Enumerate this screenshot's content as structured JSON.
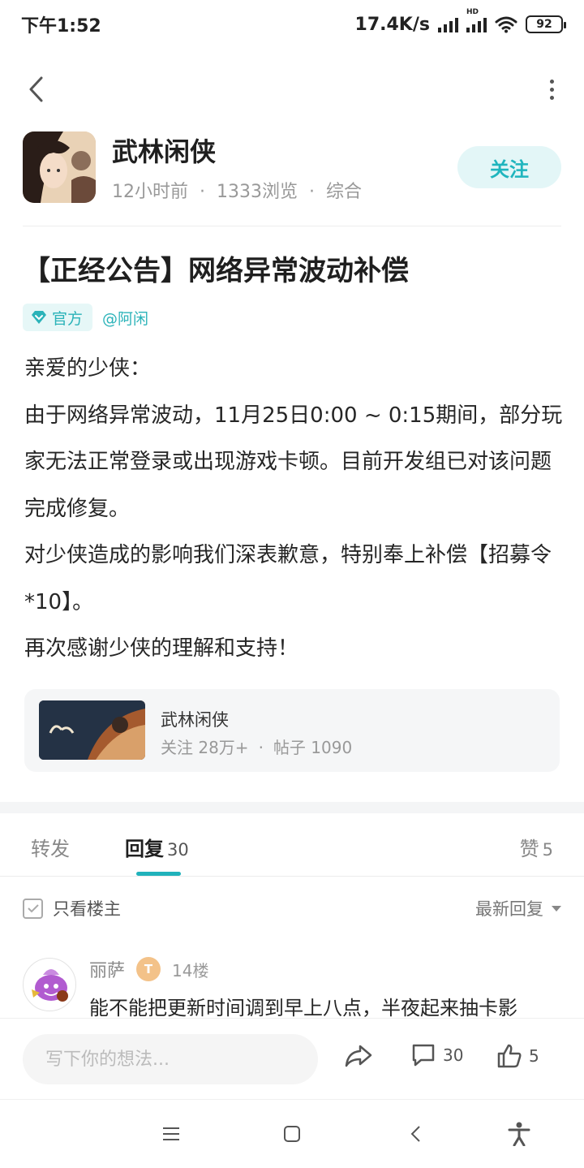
{
  "status_bar": {
    "time": "下午1:52",
    "net_speed": "17.4K/s",
    "hd_label": "HD",
    "battery": "92",
    "icons": [
      "signal-icon",
      "hd-signal-icon",
      "wifi-icon",
      "battery-icon"
    ]
  },
  "topbar": {
    "back_icon": "chevron-left-icon",
    "more_icon": "more-vertical-icon"
  },
  "author": {
    "name": "武林闲侠",
    "time_ago": "12小时前",
    "views": "1333浏览",
    "category": "综合",
    "follow_label": "关注"
  },
  "post": {
    "title": "【正经公告】网络异常波动补偿",
    "tag_official": "官方",
    "tag_mention": "@阿闲",
    "body": [
      "亲爱的少侠：",
      "由于网络异常波动，11月25日0:00 ~ 0:15期间，部分玩家无法正常登录或出现游戏卡顿。目前开发组已对该问题完成修复。",
      "对少侠造成的影响我们深表歉意，特别奉上补偿【招募令*10】。",
      "再次感谢少侠的理解和支持！"
    ]
  },
  "forum_card": {
    "name": "武林闲侠",
    "followers_label": "关注",
    "followers": "28万+",
    "posts_label": "帖子",
    "posts": "1090"
  },
  "tabs": {
    "forward": "转发",
    "reply": "回复",
    "reply_count": "30",
    "like": "赞",
    "like_count": "5"
  },
  "filter": {
    "only_owner": "只看楼主",
    "sort": "最新回复"
  },
  "reply": {
    "user": "丽萨",
    "level": "T",
    "floor": "14楼",
    "text": "能不能把更新时间调到早上八点，半夜起来抽卡影"
  },
  "action_bar": {
    "placeholder": "写下你的想法...",
    "comment_count": "30",
    "like_count": "5"
  },
  "colors": {
    "accent": "#20b2bb",
    "follow_bg": "#e3f6f7",
    "text_primary": "#262626",
    "text_secondary": "#999999",
    "level_badge": "#f3c289"
  }
}
